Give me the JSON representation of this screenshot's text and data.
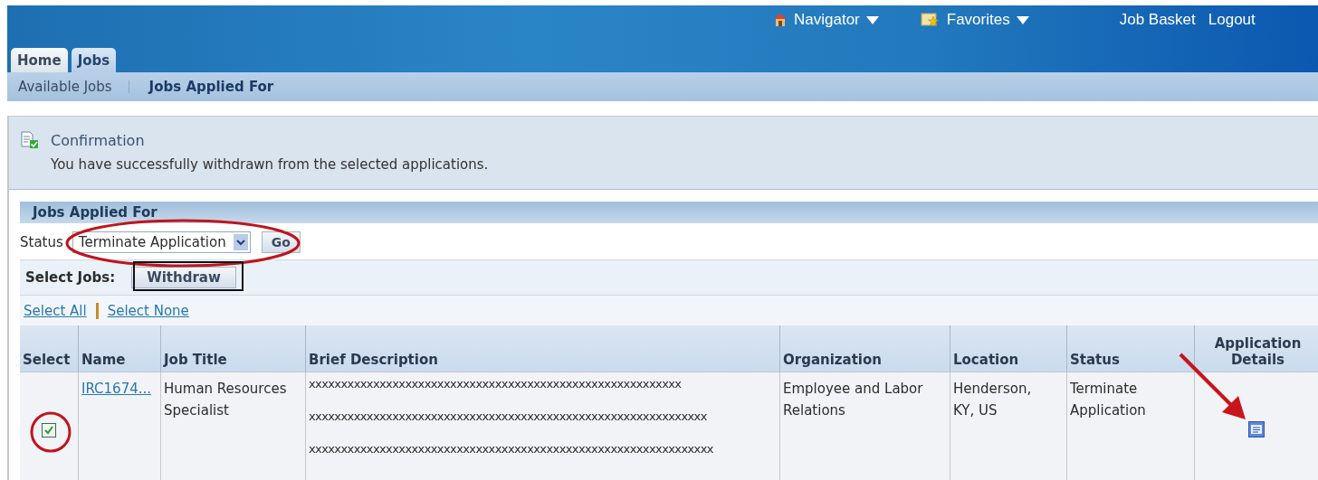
{
  "global_nav": [
    {
      "kind": "navigator",
      "label": "Navigator"
    },
    {
      "kind": "favorites",
      "label": "Favorites"
    },
    {
      "kind": "link",
      "label": "Job Basket"
    },
    {
      "kind": "link",
      "label": "Logout"
    }
  ],
  "tabs": [
    {
      "label": "Home",
      "selected": false
    },
    {
      "label": "Jobs",
      "selected": true
    }
  ],
  "subtabs": [
    {
      "label": "Available Jobs",
      "selected": false
    },
    {
      "label": "Jobs Applied For",
      "selected": true
    }
  ],
  "confirmation": {
    "title": "Confirmation",
    "message": "You have successfully withdrawn from the selected applications."
  },
  "section": {
    "title": "Jobs Applied For",
    "status_filter": {
      "label": "Status",
      "value": "Terminate Application"
    },
    "go_button": "Go",
    "select_jobs_label": "Select Jobs:",
    "withdraw_button": "Withdraw",
    "select_all": "Select All",
    "select_none": "Select None"
  },
  "table": {
    "columns": [
      "Select",
      "Name",
      "Job Title",
      "Brief Description",
      "Organization",
      "Location",
      "Status",
      "Application Details"
    ],
    "rows": [
      {
        "checked": true,
        "name": "IRC1674...",
        "job_title": "Human Resources Specialist",
        "description": [
          "xxxxxxxxxxxxxxxxxxxxxxxxxxxxxxxxxxxxxxxxxxxxxxxxxxxxxxxxxx",
          "xxxxxxxxxxxxxxxxxxxxxxxxxxxxxxxxxxxxxxxxxxxxxxxxxxxxxxxxxxxxxx",
          "xxxxxxxxxxxxxxxxxxxxxxxxxxxxxxxxxxxxxxxxxxxxxxxxxxxxxxxxxxxxxxx"
        ],
        "organization": "Employee and Labor Relations",
        "location": "Henderson, KY, US",
        "status": "Terminate Application"
      }
    ]
  }
}
